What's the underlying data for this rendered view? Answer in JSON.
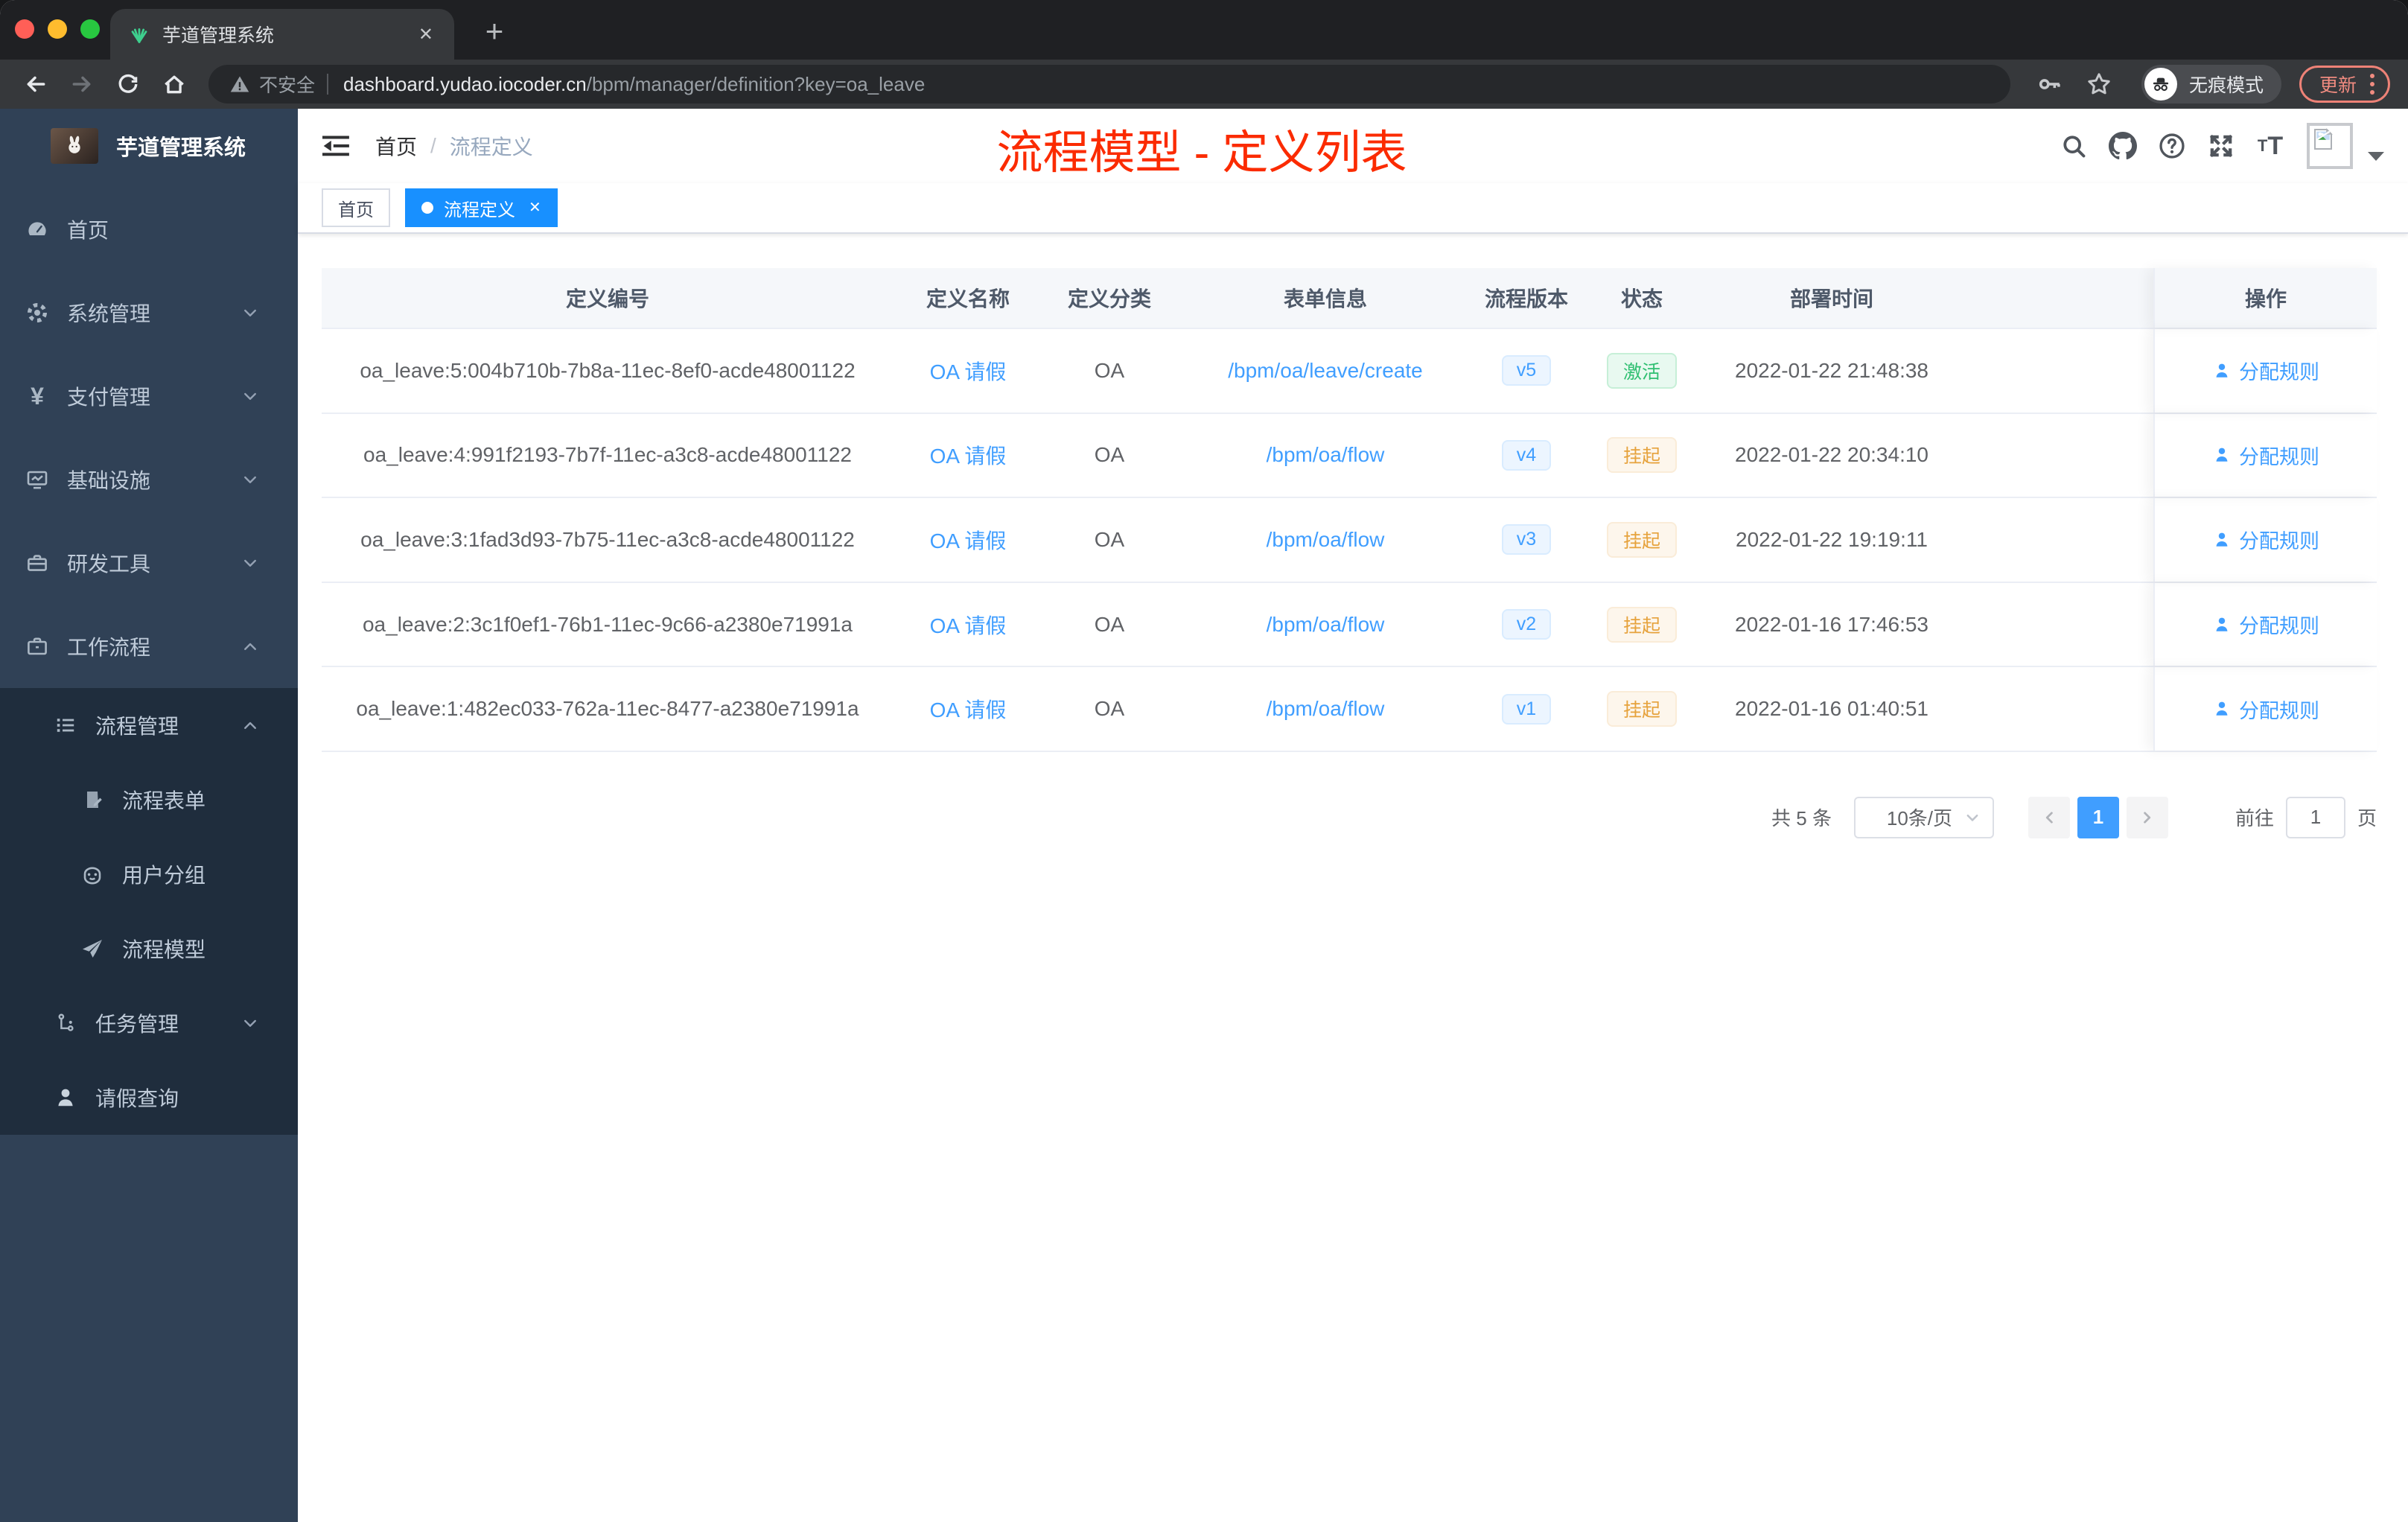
{
  "colors": {
    "accent": "#409eff",
    "tag-active": "#1890ff",
    "annotation": "#fb2b00",
    "success-text": "#2fbf71",
    "warning-text": "#e6a23c",
    "sidebar-bg": "#304156",
    "submenu-bg": "#1f2d3d"
  },
  "browser": {
    "tab_title": "芋道管理系统",
    "new_tab": "+",
    "security_label": "不安全",
    "url_host": "dashboard.yudao.iocoder.cn",
    "url_path": "/bpm/manager/definition?key=oa_leave",
    "incognito_label": "无痕模式",
    "update_label": "更新",
    "close_tab": "✕"
  },
  "sidebar": {
    "title": "芋道管理系统",
    "items": [
      {
        "label": "首页"
      },
      {
        "label": "系统管理"
      },
      {
        "label": "支付管理"
      },
      {
        "label": "基础设施"
      },
      {
        "label": "研发工具"
      },
      {
        "label": "工作流程"
      },
      {
        "label": "流程管理"
      },
      {
        "label": "流程表单"
      },
      {
        "label": "用户分组"
      },
      {
        "label": "流程模型"
      },
      {
        "label": "任务管理"
      },
      {
        "label": "请假查询"
      }
    ]
  },
  "navbar": {
    "breadcrumb_home": "首页",
    "breadcrumb_sep": "/",
    "breadcrumb_current": "流程定义",
    "annotation": "流程模型 - 定义列表",
    "font_size_icon": "T"
  },
  "tags": {
    "home": "首页",
    "active": "流程定义",
    "close": "✕"
  },
  "table": {
    "headers": [
      "定义编号",
      "定义名称",
      "定义分类",
      "表单信息",
      "流程版本",
      "状态",
      "部署时间",
      "操作"
    ],
    "rows": [
      {
        "id": "oa_leave:5:004b710b-7b8a-11ec-8ef0-acde48001122",
        "name": "OA 请假",
        "category": "OA",
        "form": "/bpm/oa/leave/create",
        "version": "v5",
        "status": "激活",
        "time": "2022-01-22 21:48:38",
        "action": "分配规则"
      },
      {
        "id": "oa_leave:4:991f2193-7b7f-11ec-a3c8-acde48001122",
        "name": "OA 请假",
        "category": "OA",
        "form": "/bpm/oa/flow",
        "version": "v4",
        "status": "挂起",
        "time": "2022-01-22 20:34:10",
        "action": "分配规则"
      },
      {
        "id": "oa_leave:3:1fad3d93-7b75-11ec-a3c8-acde48001122",
        "name": "OA 请假",
        "category": "OA",
        "form": "/bpm/oa/flow",
        "version": "v3",
        "status": "挂起",
        "time": "2022-01-22 19:19:11",
        "action": "分配规则"
      },
      {
        "id": "oa_leave:2:3c1f0ef1-76b1-11ec-9c66-a2380e71991a",
        "name": "OA 请假",
        "category": "OA",
        "form": "/bpm/oa/flow",
        "version": "v2",
        "status": "挂起",
        "time": "2022-01-16 17:46:53",
        "action": "分配规则"
      },
      {
        "id": "oa_leave:1:482ec033-762a-11ec-8477-a2380e71991a",
        "name": "OA 请假",
        "category": "OA",
        "form": "/bpm/oa/flow",
        "version": "v1",
        "status": "挂起",
        "time": "2022-01-16 01:40:51",
        "action": "分配规则"
      }
    ]
  },
  "pagination": {
    "total_label": "共 5 条",
    "page_size": "10条/页",
    "current_page": "1",
    "goto_label": "前往",
    "goto_value": "1",
    "page_unit": "页"
  }
}
